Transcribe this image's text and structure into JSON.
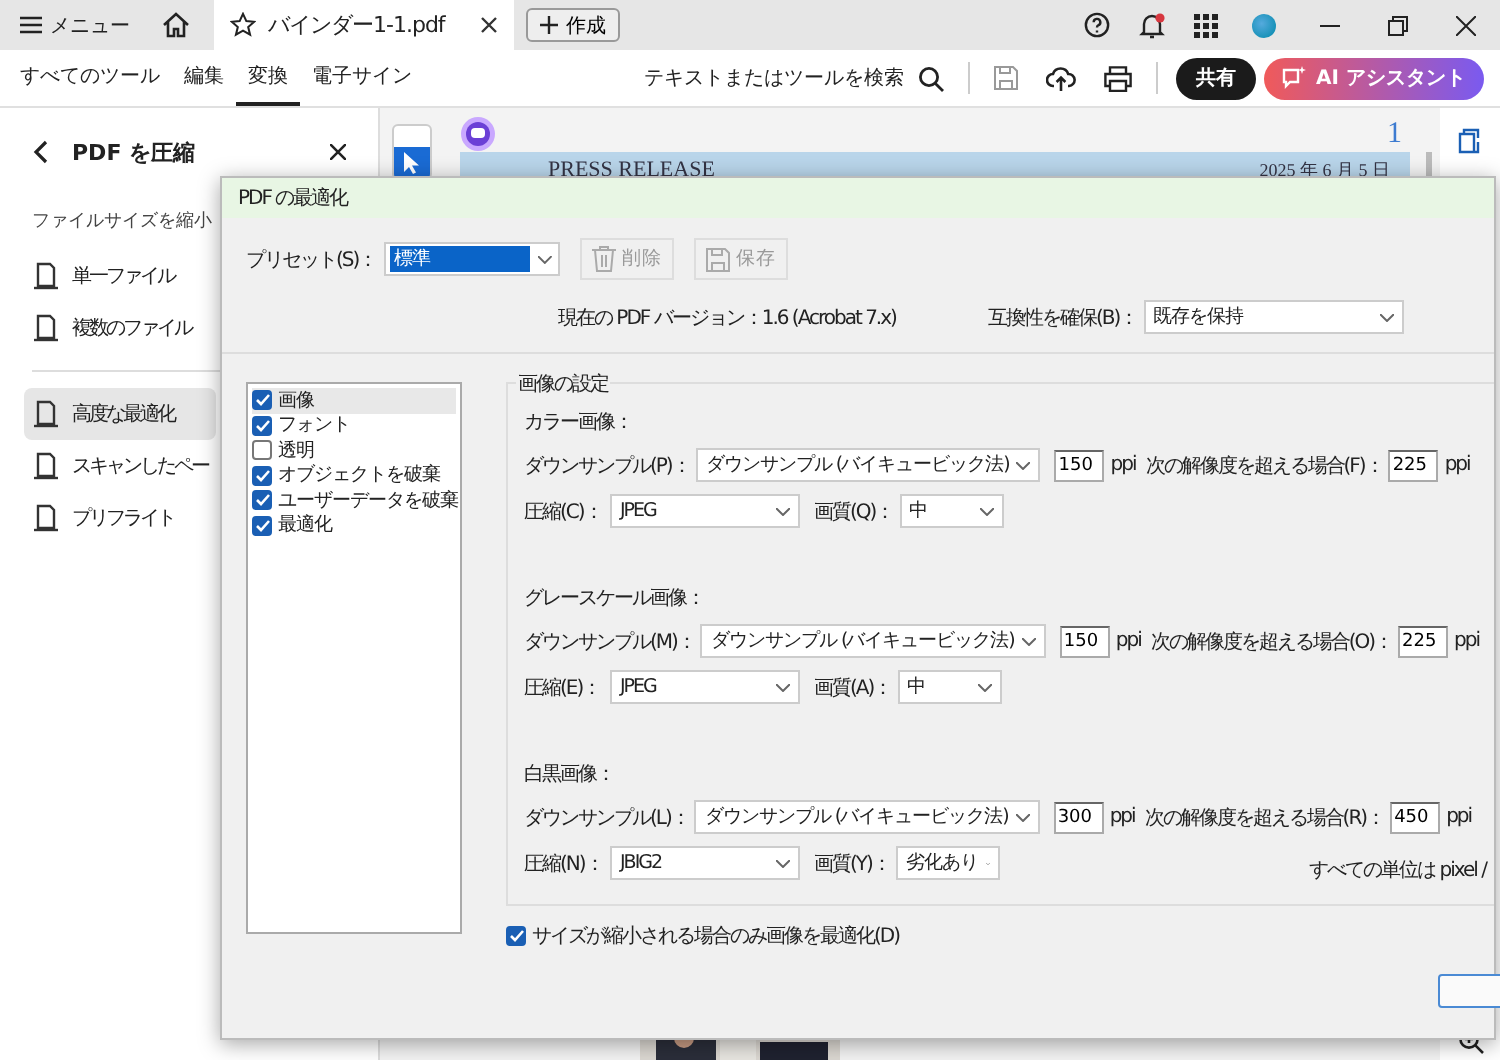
{
  "title_bar": {
    "menu": "メニュー",
    "tab": {
      "title": "バインダー1-1.pdf",
      "selected": true
    },
    "create": "作成"
  },
  "toolbar": {
    "tools": [
      {
        "label": "すべてのツール",
        "selected": false
      },
      {
        "label": "編集",
        "selected": false
      },
      {
        "label": "変換",
        "selected": true
      },
      {
        "label": "電子サイン",
        "selected": false
      }
    ],
    "search": "テキストまたはツールを検索",
    "share": "共有",
    "ai": "AI アシスタント"
  },
  "left_panel": {
    "title": "PDF を圧縮",
    "section": "ファイルサイズを縮小",
    "items": [
      {
        "label": "単一ファイル",
        "selected": false
      },
      {
        "label": "複数のファイル",
        "selected": false
      },
      {
        "label": "高度な最適化",
        "selected": true
      },
      {
        "label": "スキャンしたペー",
        "selected": false
      },
      {
        "label": "プリフライト",
        "selected": false
      }
    ]
  },
  "document": {
    "page_number": "1",
    "heading": "PRESS RELEASE",
    "date": "2025 年 6 月 5 日"
  },
  "dialog": {
    "title": "PDF の最適化",
    "preset_label": "プリセット(S)：",
    "preset_value": "標準",
    "delete": {
      "label": "削除",
      "disabled": true
    },
    "save": {
      "label": "保存",
      "disabled": true
    },
    "version": "現在の PDF バージョン：1.6 (Acrobat 7.x)",
    "compat_label": "互換性を確保(B)：",
    "compat_value": "既存を保持",
    "categories": [
      {
        "label": "画像",
        "checked": true,
        "selected": true
      },
      {
        "label": "フォント",
        "checked": true,
        "selected": false
      },
      {
        "label": "透明",
        "checked": false,
        "selected": false
      },
      {
        "label": "オブジェクトを破棄",
        "checked": true,
        "selected": false
      },
      {
        "label": "ユーザーデータを破棄",
        "checked": true,
        "selected": false
      },
      {
        "label": "最適化",
        "checked": true,
        "selected": false
      }
    ],
    "group_title": "画像の設定",
    "sections": [
      {
        "title": "カラー画像：",
        "downsample_label": "ダウンサンプル(P)：",
        "downsample_value": "ダウンサンプル (バイキュービック法)",
        "ppi": "150",
        "ppi_unit": "ppi",
        "above_label": "次の解像度を超える場合(F)：",
        "above": "225",
        "above_unit": "ppi",
        "compression_label": "圧縮(C)：",
        "compression": "JPEG",
        "quality_label": "画質(Q)：",
        "quality": "中"
      },
      {
        "title": "グレースケール画像：",
        "downsample_label": "ダウンサンプル(M)：",
        "downsample_value": "ダウンサンプル (バイキュービック法)",
        "ppi": "150",
        "ppi_unit": "ppi",
        "above_label": "次の解像度を超える場合(O)：",
        "above": "225",
        "above_unit": "ppi",
        "compression_label": "圧縮(E)：",
        "compression": "JPEG",
        "quality_label": "画質(A)：",
        "quality": "中"
      },
      {
        "title": "白黒画像：",
        "downsample_label": "ダウンサンプル(L)：",
        "downsample_value": "ダウンサンプル (バイキュービック法)",
        "ppi": "300",
        "ppi_unit": "ppi",
        "above_label": "次の解像度を超える場合(R)：",
        "above": "450",
        "above_unit": "ppi",
        "compression_label": "圧縮(N)：",
        "compression": "JBIG2",
        "quality_label": "画質(Y)：",
        "quality": "劣化あり"
      }
    ],
    "units_note": "すべての単位は pixel /",
    "only_if_smaller": {
      "label": "サイズが縮小される場合のみ画像を最適化(D)",
      "checked": true
    }
  }
}
